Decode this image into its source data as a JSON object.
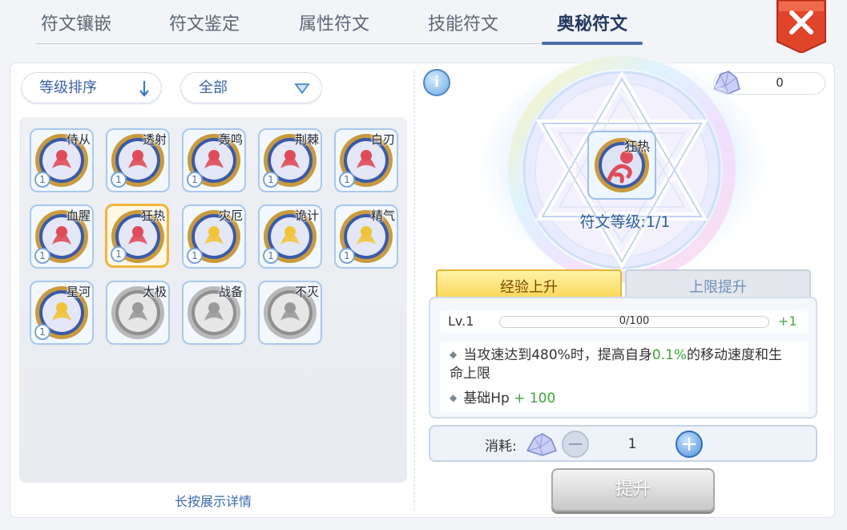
{
  "tabs": [
    {
      "label": "符文镶嵌"
    },
    {
      "label": "符文鉴定"
    },
    {
      "label": "属性符文"
    },
    {
      "label": "技能符文"
    },
    {
      "label": "奥秘符文"
    }
  ],
  "active_tab": "奥秘符文",
  "close_icon": "close-x-icon",
  "sort_dropdown": {
    "label": "等级排序",
    "icon": "arrow-down-icon"
  },
  "filter_dropdown": {
    "label": "全部",
    "icon": "triangle-down-icon"
  },
  "runes": [
    {
      "name": "侍从",
      "level": "1",
      "locked": false,
      "color": "#e04b5a",
      "icon": "servant-icon"
    },
    {
      "name": "透射",
      "level": "1",
      "locked": false,
      "color": "#e04b5a",
      "icon": "pierce-icon"
    },
    {
      "name": "轰鸣",
      "level": "1",
      "locked": false,
      "color": "#e04b5a",
      "icon": "roar-icon"
    },
    {
      "name": "荆棘",
      "level": "1",
      "locked": false,
      "color": "#e04b5a",
      "icon": "thorn-icon"
    },
    {
      "name": "白刃",
      "level": "1",
      "locked": false,
      "color": "#e04b5a",
      "icon": "blade-icon"
    },
    {
      "name": "血腥",
      "level": "1",
      "locked": false,
      "color": "#e04b5a",
      "icon": "blood-icon"
    },
    {
      "name": "狂热",
      "level": "1",
      "locked": false,
      "color": "#e04b5a",
      "icon": "frenzy-icon",
      "selected": true
    },
    {
      "name": "灾厄",
      "level": "1",
      "locked": false,
      "color": "#f2c43a",
      "icon": "calamity-icon"
    },
    {
      "name": "诡计",
      "level": "1",
      "locked": false,
      "color": "#f2c43a",
      "icon": "trick-icon"
    },
    {
      "name": "精气",
      "level": "1",
      "locked": false,
      "color": "#f2c43a",
      "icon": "essence-icon"
    },
    {
      "name": "星河",
      "level": "1",
      "locked": false,
      "color": "#f2c43a",
      "icon": "galaxy-icon"
    },
    {
      "name": "太极",
      "level": "",
      "locked": true,
      "color": "#9a9a9a",
      "icon": "taiji-icon"
    },
    {
      "name": "战备",
      "level": "",
      "locked": true,
      "color": "#9a9a9a",
      "icon": "readiness-icon"
    },
    {
      "name": "不灭",
      "level": "",
      "locked": true,
      "color": "#9a9a9a",
      "icon": "immortal-icon"
    }
  ],
  "hint": "长按展示详情",
  "info_icon": "i",
  "currency": {
    "value": "0",
    "icon": "crystal-icon"
  },
  "selected_rune": {
    "name": "狂热",
    "level_label": "符文等级:1/1"
  },
  "subtabs": [
    {
      "label": "经验上升"
    },
    {
      "label": "上限提升"
    }
  ],
  "level_row": {
    "label": "Lv.1",
    "exp_text": "0/100",
    "exp_progress": 0,
    "next": "+1"
  },
  "effects": {
    "line1_prefix": "当攻速达到480%时，提高自身",
    "line1_value": "0.1%",
    "line1_suffix": "的移动速度和生",
    "line1_wrap": "命上限",
    "line2_prefix": "基础Hp",
    "line2_value": "+ 100"
  },
  "cost": {
    "label": "消耗:",
    "quantity": "1",
    "minus": "−",
    "plus": "+"
  },
  "upgrade_button": "提升",
  "colors": {
    "accent": "#4a6ea8",
    "close_red": "#e0452c",
    "select_gold": "#f3b43a",
    "positive_green": "#3fa33a"
  }
}
